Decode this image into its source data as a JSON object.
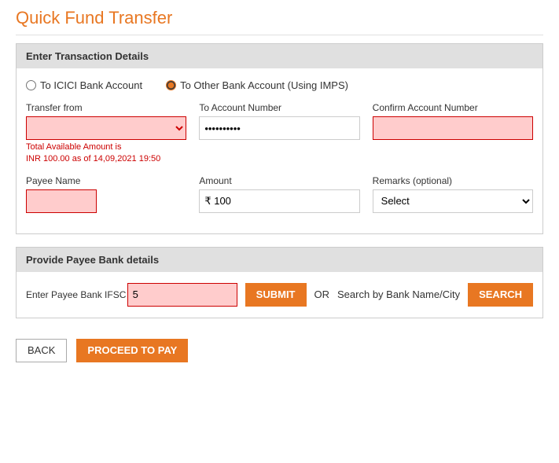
{
  "page": {
    "title": "Quick Fund Transfer"
  },
  "transaction_section": {
    "header": "Enter Transaction Details",
    "radio_options": [
      {
        "id": "radio-icici",
        "label": "To ICICI Bank Account",
        "checked": false
      },
      {
        "id": "radio-imps",
        "label": "To Other Bank Account (Using IMPS)",
        "checked": true
      }
    ],
    "transfer_from_label": "Transfer from",
    "account_number_label": "To Account Number",
    "confirm_account_label": "Confirm Account Number",
    "account_number_value": "··········",
    "total_available": "Total Available Amount is",
    "amount_info": "INR 100.00 as of 14,09,2021 19:50",
    "payee_name_label": "Payee Name",
    "amount_label": "Amount",
    "amount_value": "₹ 100",
    "remarks_label": "Remarks (optional)",
    "remarks_placeholder": "Select"
  },
  "bank_section": {
    "header": "Provide Payee Bank details",
    "ifsc_label": "Enter Payee Bank IFSC Code*",
    "ifsc_value": "5",
    "submit_label": "SUBMIT",
    "or_text": "OR",
    "search_by_label": "Search by Bank Name/City",
    "search_label": "SEARCH"
  },
  "footer": {
    "back_label": "BACK",
    "proceed_label": "PROCEED TO PAY"
  }
}
